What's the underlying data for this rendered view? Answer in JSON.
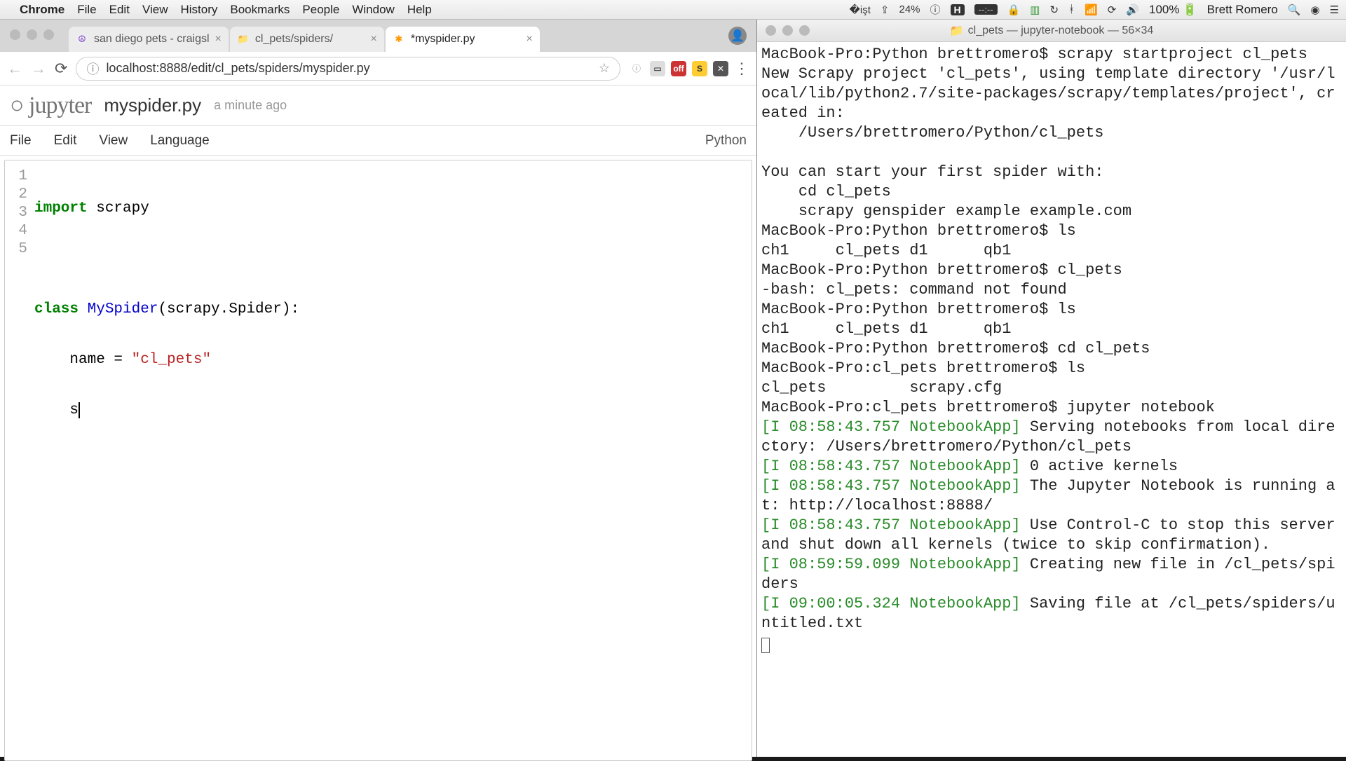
{
  "menubar": {
    "app": "Chrome",
    "items": [
      "File",
      "Edit",
      "View",
      "History",
      "Bookmarks",
      "People",
      "Window",
      "Help"
    ],
    "percent": "24%",
    "battery": "100%",
    "charge_icon": "⚡",
    "user": "Brett Romero",
    "hbox": "H",
    "dashes": "--:--"
  },
  "chrome": {
    "tabs": [
      {
        "title": "san diego pets - craigsl",
        "favicon": "☮",
        "favcolor": "#7a3cc9"
      },
      {
        "title": "cl_pets/spiders/",
        "favicon": "📁",
        "favcolor": "#888"
      },
      {
        "title": "*myspider.py",
        "favicon": "✱",
        "favcolor": "#ff9800",
        "active": true
      }
    ],
    "url": "localhost:8888/edit/cl_pets/spiders/myspider.py",
    "ext_off": "off",
    "ext_s": "S"
  },
  "jupyter": {
    "logo": "jupyter",
    "filename": "myspider.py",
    "time": "a minute ago",
    "menus": [
      "File",
      "Edit",
      "View",
      "Language"
    ],
    "language": "Python"
  },
  "code": {
    "lines": [
      "1",
      "2",
      "3",
      "4",
      "5"
    ],
    "l1_kw": "import",
    "l1_rest": " scrapy",
    "l3_kw": "class",
    "l3_cls": " MySpider",
    "l3_rest": "(scrapy.Spider):",
    "l4_pre": "    name = ",
    "l4_str": "\"cl_pets\"",
    "l5": "    s"
  },
  "terminal": {
    "title": "cl_pets — jupyter-notebook — 56×34",
    "prompt": "MacBook-Pro:Python brettromero$ ",
    "prompt2": "MacBook-Pro:cl_pets brettromero$ ",
    "lines": [
      {
        "t": "MacBook-Pro:Python brettromero$ scrapy startproject cl_pets"
      },
      {
        "t": "New Scrapy project 'cl_pets', using template directory '/usr/local/lib/python2.7/site-packages/scrapy/templates/project', created in:"
      },
      {
        "t": "    /Users/brettromero/Python/cl_pets"
      },
      {
        "t": ""
      },
      {
        "t": "You can start your first spider with:"
      },
      {
        "t": "    cd cl_pets"
      },
      {
        "t": "    scrapy genspider example example.com"
      },
      {
        "t": "MacBook-Pro:Python brettromero$ ls"
      },
      {
        "t": "ch1     cl_pets d1      qb1"
      },
      {
        "t": "MacBook-Pro:Python brettromero$ cl_pets"
      },
      {
        "t": "-bash: cl_pets: command not found"
      },
      {
        "t": "MacBook-Pro:Python brettromero$ ls"
      },
      {
        "t": "ch1     cl_pets d1      qb1"
      },
      {
        "t": "MacBook-Pro:Python brettromero$ cd cl_pets"
      },
      {
        "t": "MacBook-Pro:cl_pets brettromero$ ls"
      },
      {
        "t": "cl_pets         scrapy.cfg"
      },
      {
        "t": "MacBook-Pro:cl_pets brettromero$ jupyter notebook"
      }
    ],
    "loglines": [
      {
        "ts": "[I 08:58:43.757 NotebookApp]",
        "msg": " Serving notebooks from local directory: /Users/brettromero/Python/cl_pets"
      },
      {
        "ts": "[I 08:58:43.757 NotebookApp]",
        "msg": " 0 active kernels"
      },
      {
        "ts": "[I 08:58:43.757 NotebookApp]",
        "msg": " The Jupyter Notebook is running at: http://localhost:8888/"
      },
      {
        "ts": "[I 08:58:43.757 NotebookApp]",
        "msg": " Use Control-C to stop this server and shut down all kernels (twice to skip confirmation)."
      },
      {
        "ts": "[I 08:59:59.099 NotebookApp]",
        "msg": " Creating new file in /cl_pets/spiders"
      },
      {
        "ts": "[I 09:00:05.324 NotebookApp]",
        "msg": " Saving file at /cl_pets/spiders/untitled.txt"
      }
    ]
  }
}
